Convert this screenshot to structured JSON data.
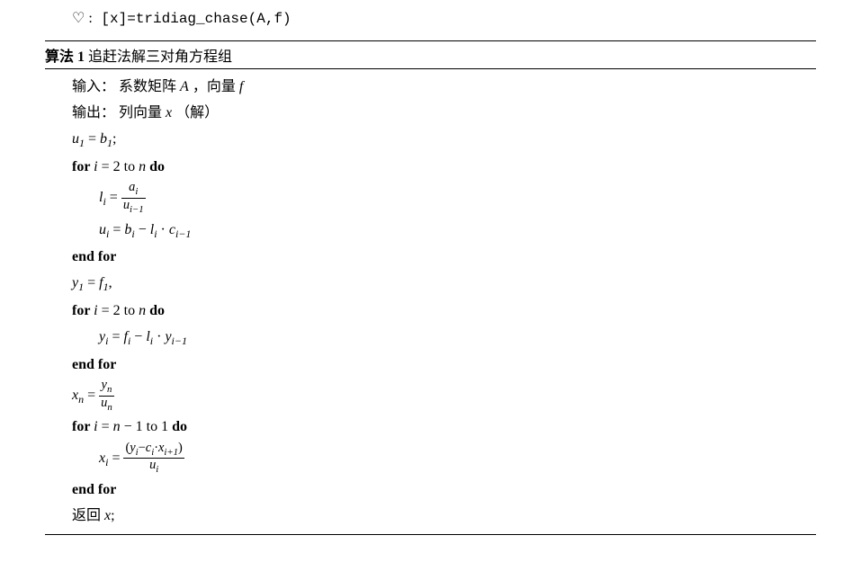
{
  "header": {
    "symbol": "♡ :",
    "code": "[x]=tridiag_chase(A,f)"
  },
  "algo": {
    "label": "算法 1",
    "title": "追赶法解三对角方程组",
    "input_label": "输入：",
    "input_text": "系数矩阵 ",
    "input_var1": "A",
    "input_sep": " ，向量 ",
    "input_var2": "f",
    "output_label": "输出：",
    "output_text": "列向量 ",
    "output_var": "x",
    "output_note": " （解）",
    "line1_lhs": "u",
    "line1_sub": "1",
    "line1_eq": " = ",
    "line1_rhs": "b",
    "line1_rhs_sub": "1",
    "line1_end": ";",
    "for1_pre": "for ",
    "for1_var": "i",
    "for1_mid": " = 2 to ",
    "for1_n": "n",
    "for1_post": " do",
    "for1_body1_lhs": "l",
    "for1_body1_sub": "i",
    "for1_body1_eq": " = ",
    "for1_body1_num": "a",
    "for1_body1_num_sub": "i",
    "for1_body1_den": "u",
    "for1_body1_den_sub": "i−1",
    "for1_body2_lhs": "u",
    "for1_body2_sub": "i",
    "for1_body2_eq": " = ",
    "for1_body2_b": "b",
    "for1_body2_b_sub": "i",
    "for1_body2_minus": " − ",
    "for1_body2_l": "l",
    "for1_body2_l_sub": "i",
    "for1_body2_dot": " · ",
    "for1_body2_c": "c",
    "for1_body2_c_sub": "i−1",
    "endfor": "end for",
    "line_y1_lhs": "y",
    "line_y1_sub": "1",
    "line_y1_eq": " = ",
    "line_y1_rhs": "f",
    "line_y1_rhs_sub": "1",
    "line_y1_end": ",",
    "for2_pre": "for ",
    "for2_var": "i",
    "for2_mid": " = 2 to ",
    "for2_n": "n",
    "for2_post": " do",
    "for2_body_lhs": "y",
    "for2_body_sub": "i",
    "for2_body_eq": " = ",
    "for2_body_f": "f",
    "for2_body_f_sub": "i",
    "for2_body_minus": " − ",
    "for2_body_l": "l",
    "for2_body_l_sub": "i",
    "for2_body_dot": " · ",
    "for2_body_y": "y",
    "for2_body_y_sub": "i−1",
    "line_xn_lhs": "x",
    "line_xn_sub": "n",
    "line_xn_eq": " = ",
    "line_xn_num": "y",
    "line_xn_num_sub": "n",
    "line_xn_den": "u",
    "line_xn_den_sub": "n",
    "for3_pre": "for ",
    "for3_var": "i",
    "for3_mid": " = ",
    "for3_n": "n",
    "for3_minus1": " − 1 to 1",
    "for3_post": " do",
    "for3_body_lhs": "x",
    "for3_body_sub": "i",
    "for3_body_eq": " = ",
    "for3_num_open": "(",
    "for3_num_y": "y",
    "for3_num_y_sub": "i",
    "for3_num_minus": "−",
    "for3_num_c": "c",
    "for3_num_c_sub": "i",
    "for3_num_dot": "·",
    "for3_num_x": "x",
    "for3_num_x_sub": "i+1",
    "for3_num_close": ")",
    "for3_den": "u",
    "for3_den_sub": "i",
    "return_label": "返回 ",
    "return_var": "x",
    "return_end": ";"
  }
}
